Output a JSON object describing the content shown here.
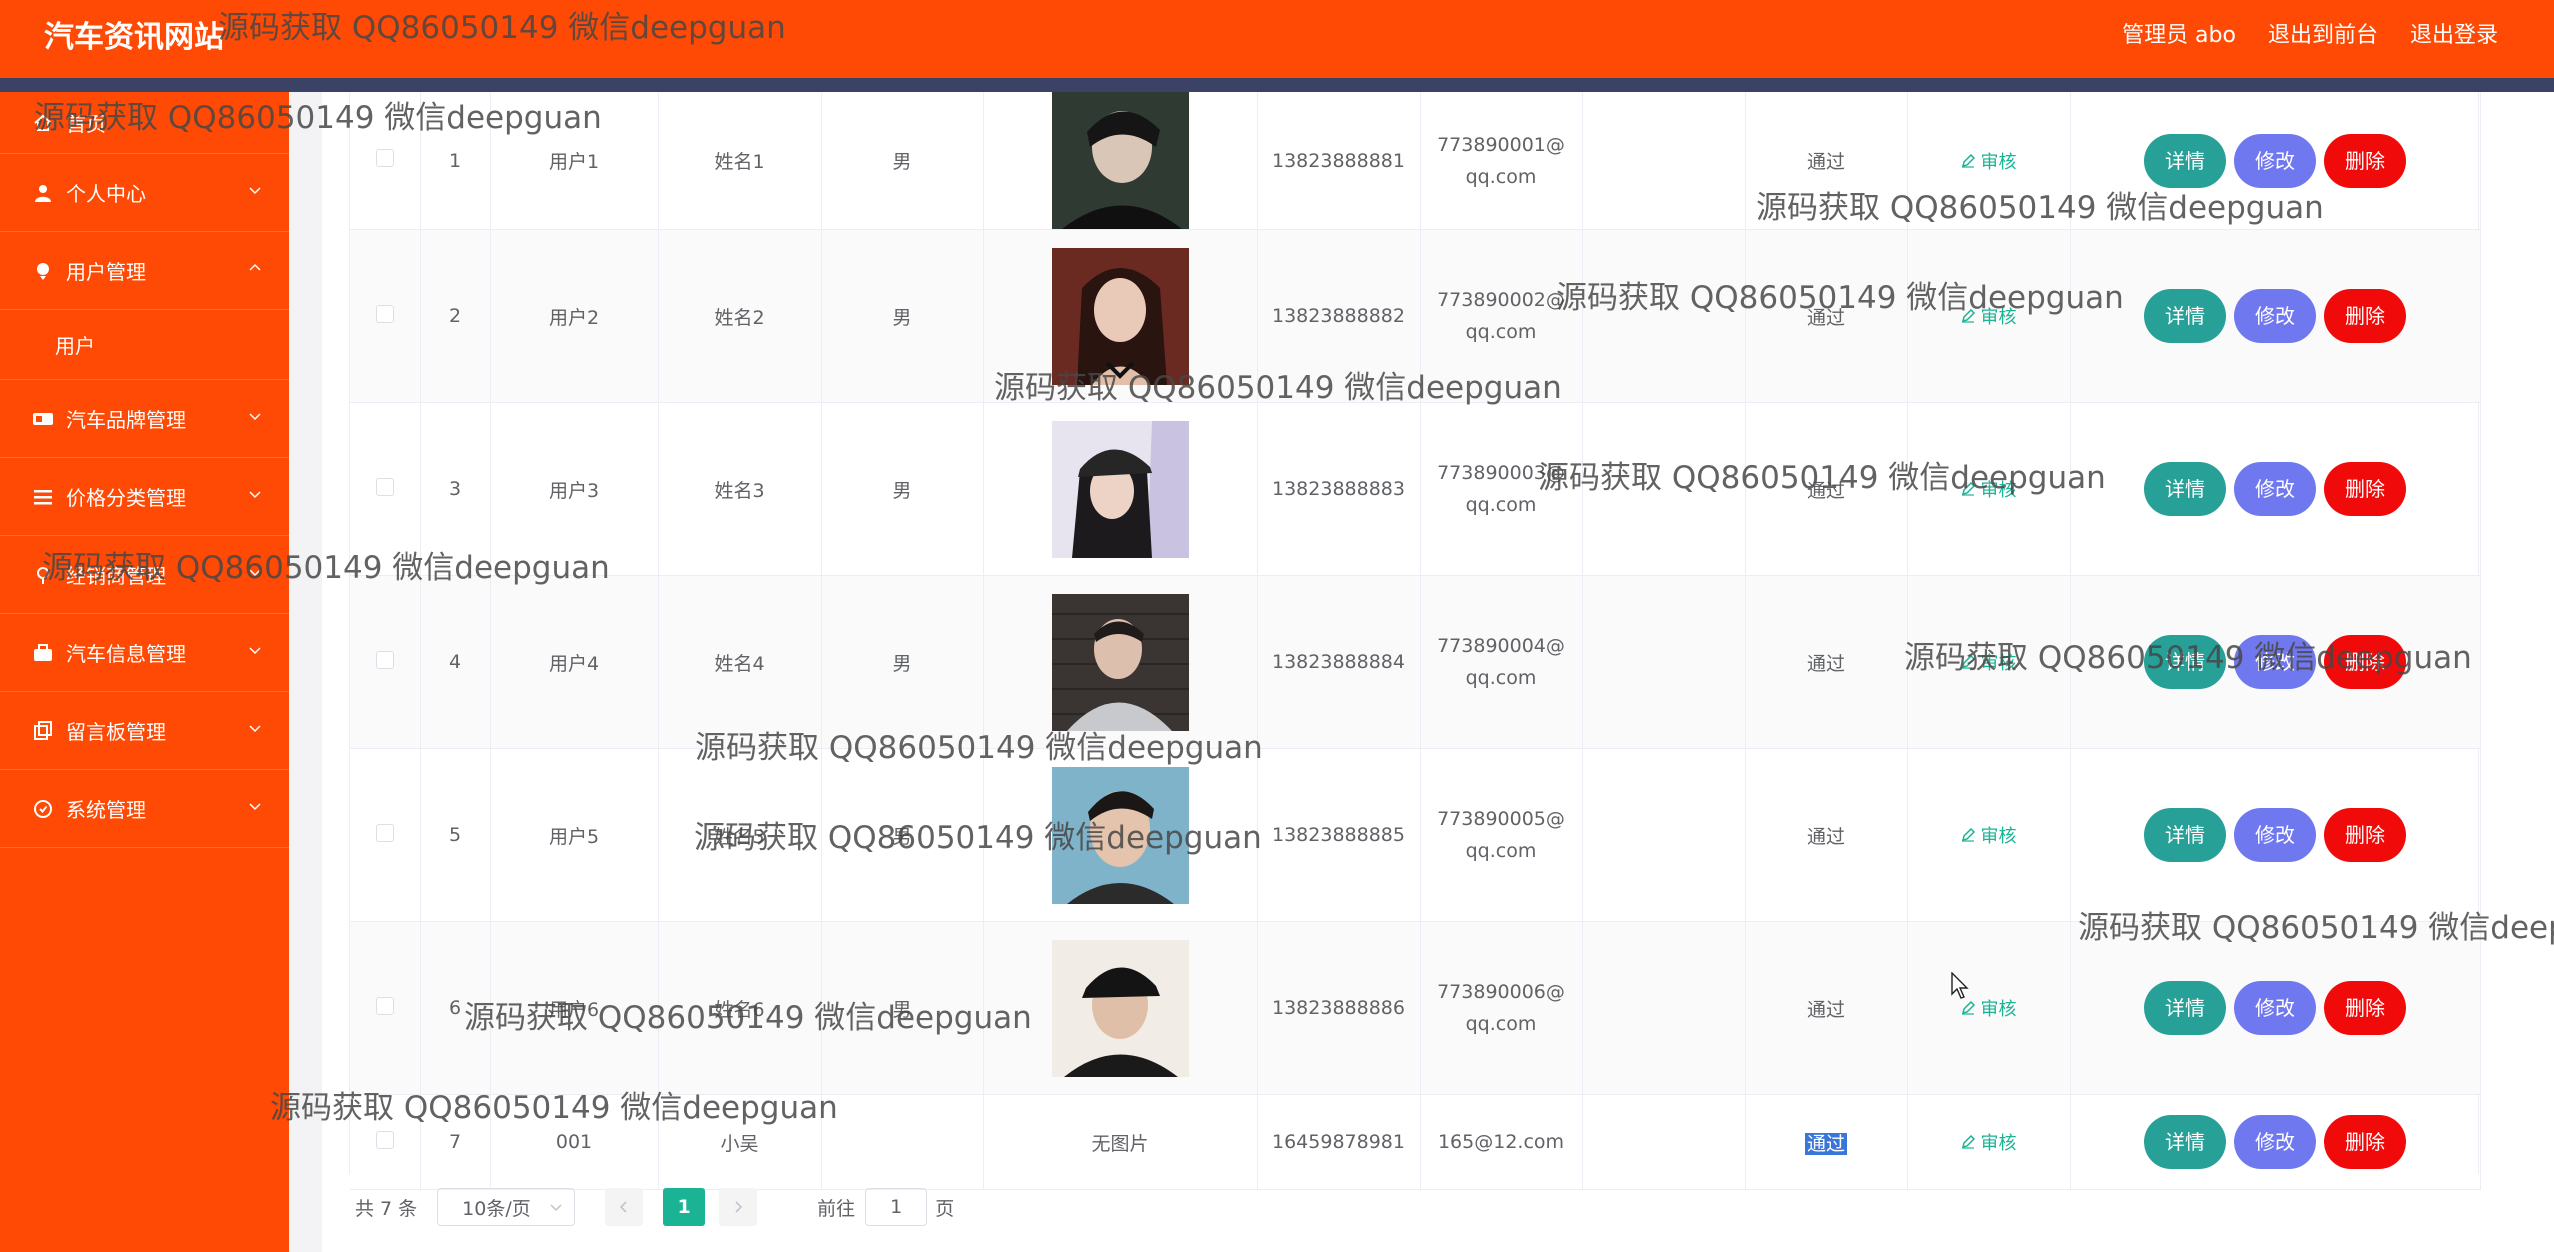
{
  "header": {
    "site_title": "汽车资讯网站",
    "admin_label": "管理员 abo",
    "to_front": "退出到前台",
    "logout": "退出登录"
  },
  "sidebar": {
    "items": [
      {
        "label": "首页",
        "icon": "home-icon"
      },
      {
        "label": "个人中心",
        "icon": "user-icon"
      },
      {
        "label": "用户管理",
        "icon": "users-icon"
      },
      {
        "label": "用户",
        "sub": true
      },
      {
        "label": "汽车品牌管理",
        "icon": "tag-icon"
      },
      {
        "label": "价格分类管理",
        "icon": "list-icon"
      },
      {
        "label": "经销商管理",
        "icon": "shop-icon"
      },
      {
        "label": "汽车信息管理",
        "icon": "briefcase-icon"
      },
      {
        "label": "留言板管理",
        "icon": "copy-icon"
      },
      {
        "label": "系统管理",
        "icon": "settings-icon"
      }
    ]
  },
  "table": {
    "audit_label": "审核",
    "buttons": {
      "detail": "详情",
      "edit": "修改",
      "delete": "删除"
    },
    "no_image": "无图片",
    "rows": [
      {
        "idx": "1",
        "account": "用户1",
        "name": "姓名1",
        "gender": "男",
        "phone": "13823888881",
        "email": "773890001@qq.com",
        "status": "通过",
        "photo": "man-dark"
      },
      {
        "idx": "2",
        "account": "用户2",
        "name": "姓名2",
        "gender": "男",
        "phone": "13823888882",
        "email": "773890002@qq.com",
        "status": "通过",
        "photo": "woman-red"
      },
      {
        "idx": "3",
        "account": "用户3",
        "name": "姓名3",
        "gender": "男",
        "phone": "13823888883",
        "email": "773890003@qq.com",
        "status": "通过",
        "photo": "woman-cap"
      },
      {
        "idx": "4",
        "account": "用户4",
        "name": "姓名4",
        "gender": "男",
        "phone": "13823888884",
        "email": "773890004@qq.com",
        "status": "通过",
        "photo": "man-brick"
      },
      {
        "idx": "5",
        "account": "用户5",
        "name": "姓名5",
        "gender": "男",
        "phone": "13823888885",
        "email": "773890005@qq.com",
        "status": "通过",
        "photo": "man-light"
      },
      {
        "idx": "6",
        "account": "用户6",
        "name": "姓名6",
        "gender": "男",
        "phone": "13823888886",
        "email": "773890006@qq.com",
        "status": "通过",
        "photo": "man-cap"
      },
      {
        "idx": "7",
        "account": "001",
        "name": "小吴",
        "gender": "",
        "phone": "16459878981",
        "email": "165@12.com",
        "status": "通过",
        "photo": ""
      }
    ]
  },
  "pagination": {
    "total": "共 7 条",
    "page_size": "10条/页",
    "current": "1",
    "goto_prefix": "前往",
    "goto_value": "1",
    "goto_suffix": "页"
  },
  "watermark": "源码获取 QQ86050149 微信deepguan",
  "colors": {
    "header": "#ff4a05",
    "header_stripe": "#3b4265",
    "detail": "#27a197",
    "edit": "#7078f0",
    "delete": "#f00a0a",
    "accent": "#1ab394"
  }
}
